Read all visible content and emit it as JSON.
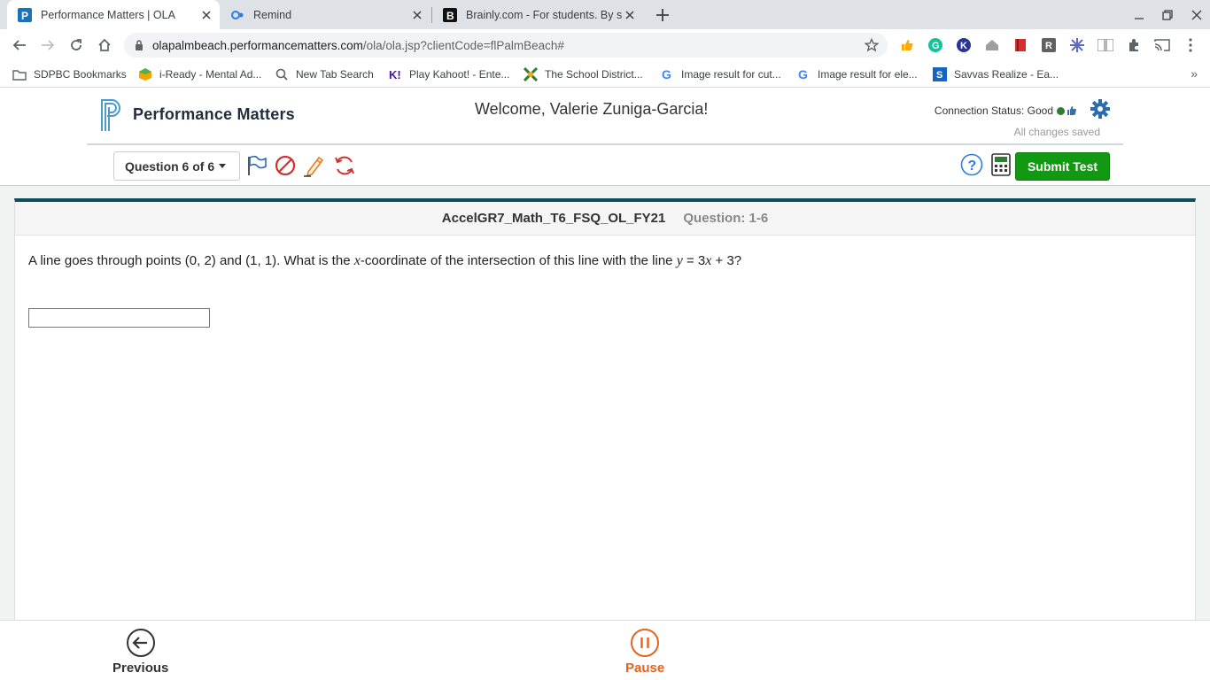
{
  "browser": {
    "tabs": [
      {
        "title": "Performance Matters | OLA",
        "active": true
      },
      {
        "title": "Remind",
        "active": false
      },
      {
        "title": "Brainly.com - For students. By st",
        "active": false
      }
    ],
    "url": {
      "host": "olapalmbeach.performancematters.com",
      "path": "/ola/ola.jsp?clientCode=flPalmBeach#"
    },
    "bookmarks": [
      {
        "label": "SDPBC Bookmarks",
        "icon": "folder-icon"
      },
      {
        "label": "i-Ready - Mental Ad...",
        "icon": "iready-icon"
      },
      {
        "label": "New Tab Search",
        "icon": "search-icon"
      },
      {
        "label": "Play Kahoot! - Ente...",
        "icon": "kahoot-icon"
      },
      {
        "label": "The School District...",
        "icon": "district-icon"
      },
      {
        "label": "Image result for cut...",
        "icon": "google-icon"
      },
      {
        "label": "Image result for ele...",
        "icon": "google-icon"
      },
      {
        "label": "Savvas Realize - Ea...",
        "icon": "savvas-icon"
      }
    ],
    "bookmarks_overflow": "»"
  },
  "app": {
    "logo_text": "Performance Matters",
    "welcome": "Welcome, Valerie Zuniga-Garcia!",
    "connection_status": "Connection Status: Good",
    "saved_status": "All changes saved",
    "question_selector": "Question 6 of 6",
    "submit_label": "Submit Test",
    "accent_color": "#119a11"
  },
  "test": {
    "name": "AccelGR7_Math_T6_FSQ_OL_FY21",
    "question_label": "Question: 1-6",
    "question_parts": {
      "p1": "A line goes through points (0, 2) and (1, 1).  What is the ",
      "var_x": "x",
      "p2": "-coordinate of the intersection of this line with the line ",
      "var_y": "y",
      "p3": " = 3",
      "var_x2": "x",
      "p4": " + 3?"
    },
    "answer_value": ""
  },
  "footer": {
    "previous_label": "Previous",
    "pause_label": "Pause"
  }
}
